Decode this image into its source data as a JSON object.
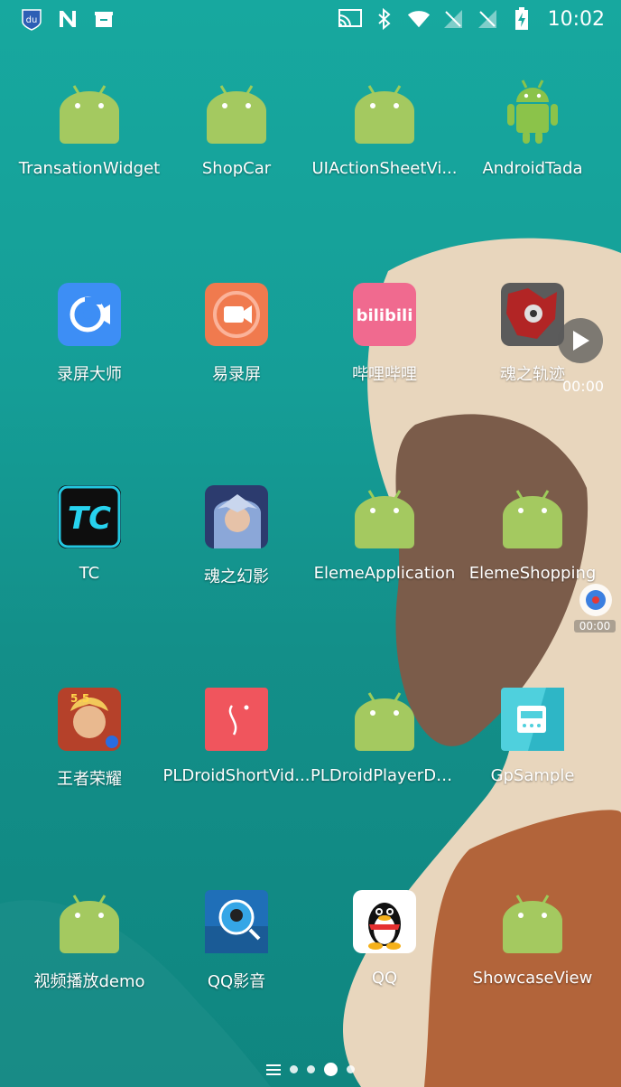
{
  "status_bar": {
    "time": "10:02",
    "left_icons": [
      "app-badge-icon",
      "n-notification-icon",
      "store-icon"
    ],
    "right_icons": [
      "cast-icon",
      "bluetooth-icon",
      "wifi-icon",
      "no-signal-icon",
      "no-signal-icon",
      "battery-charging-icon"
    ]
  },
  "apps": [
    {
      "label": "TransationWidget",
      "icon": "android-icon"
    },
    {
      "label": "ShopCar",
      "icon": "android-icon"
    },
    {
      "label": "UIActionSheetVi...",
      "icon": "android-icon"
    },
    {
      "label": "AndroidTada",
      "icon": "android-robot-icon"
    },
    {
      "label": "录屏大师",
      "icon": "screen-recorder-icon"
    },
    {
      "label": "易录屏",
      "icon": "video-record-icon"
    },
    {
      "label": "哔哩哔哩",
      "icon": "bilibili-icon"
    },
    {
      "label": "魂之轨迹",
      "icon": "game-icon"
    },
    {
      "label": "TC",
      "icon": "tc-icon"
    },
    {
      "label": "魂之幻影",
      "icon": "game-character-icon"
    },
    {
      "label": "ElemeApplication",
      "icon": "android-icon"
    },
    {
      "label": "ElemeShopping",
      "icon": "android-icon"
    },
    {
      "label": "王者荣耀",
      "icon": "honor-of-kings-icon"
    },
    {
      "label": "PLDroidShortVid...",
      "icon": "pldroid-icon"
    },
    {
      "label": "PLDroidPlayerDe...",
      "icon": "android-icon"
    },
    {
      "label": "GpSample",
      "icon": "gpsample-icon"
    },
    {
      "label": "视频播放demo",
      "icon": "android-icon"
    },
    {
      "label": "QQ影音",
      "icon": "qq-player-icon"
    },
    {
      "label": "QQ",
      "icon": "qq-penguin-icon"
    },
    {
      "label": "ShowcaseView",
      "icon": "android-icon"
    }
  ],
  "overlay": {
    "play_time": "00:00",
    "record_time": "00:00"
  },
  "page_indicator": {
    "pages": 4,
    "current": 3
  }
}
